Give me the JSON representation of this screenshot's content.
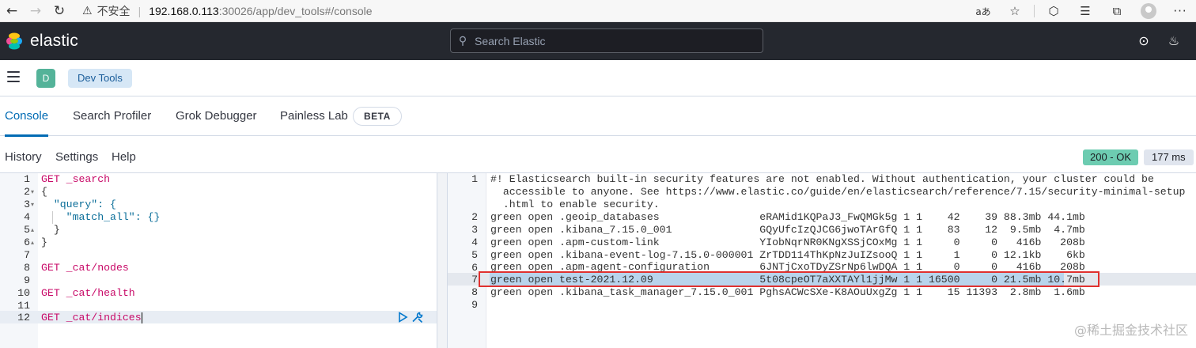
{
  "browser": {
    "back_icon": "←",
    "forward_icon": "→",
    "reload_icon": "↻",
    "warning_icon": "⚠",
    "insecure_label": "不安全",
    "separator": "|",
    "url_host": "192.168.0.113",
    "url_path": ":30026/app/dev_tools#/console",
    "read_aloud_icon": "aあ",
    "favorite_icon": "☆",
    "extensions_icon": "⬡",
    "collections_icon": "☰",
    "tabs_icon": "⧉",
    "menu_icon": "···"
  },
  "header": {
    "brand": "elastic",
    "search_placeholder": "Search Elastic",
    "search_icon": "⚲",
    "help_icon": "⊙",
    "news_icon": "♨"
  },
  "breadcrumb": {
    "space_initial": "D",
    "current": "Dev Tools"
  },
  "tabs": [
    {
      "label": "Console",
      "active": true
    },
    {
      "label": "Search Profiler"
    },
    {
      "label": "Grok Debugger"
    },
    {
      "label": "Painless Lab"
    }
  ],
  "beta_label": "BETA",
  "console_menu": {
    "history": "History",
    "settings": "Settings",
    "help": "Help"
  },
  "response_status": "200 - OK",
  "response_time": "177 ms",
  "request_lines": [
    {
      "n": "1",
      "text": "GET _search"
    },
    {
      "n": "2",
      "text": "{"
    },
    {
      "n": "3",
      "text": "  \"query\": {"
    },
    {
      "n": "4",
      "text": "    \"match_all\": {}"
    },
    {
      "n": "5",
      "text": "  }"
    },
    {
      "n": "6",
      "text": "}"
    },
    {
      "n": "7",
      "text": ""
    },
    {
      "n": "8",
      "text": "GET _cat/nodes"
    },
    {
      "n": "9",
      "text": ""
    },
    {
      "n": "10",
      "text": "GET _cat/health"
    },
    {
      "n": "11",
      "text": ""
    },
    {
      "n": "12",
      "text": "GET _cat/indices"
    }
  ],
  "output": {
    "line_numbers": [
      "1",
      "",
      "",
      "2",
      "3",
      "4",
      "5",
      "6",
      "7",
      "8",
      "9"
    ],
    "lines": [
      "#! Elasticsearch built-in security features are not enabled. Without authentication, your cluster could be",
      "  accessible to anyone. See https://www.elastic.co/guide/en/elasticsearch/reference/7.15/security-minimal-setup",
      "  .html to enable security.",
      "green open .geoip_databases                eRAMid1KQPaJ3_FwQMGk5g 1 1    42    39 88.3mb 44.1mb",
      "green open .kibana_7.15.0_001              GQyUfcIzQJCG6jwoTArGfQ 1 1    83    12  9.5mb  4.7mb",
      "green open .apm-custom-link                YIobNqrNR0KNgXSSjCOxMg 1 1     0     0   416b   208b",
      "green open .kibana-event-log-7.15.0-000001 ZrTDD114ThKpNzJuIZsooQ 1 1     1     0 12.1kb    6kb",
      "green open .apm-agent-configuration        6JNTjCxoTDyZSrNp6lwDQA 1 1     0     0   416b   208b",
      "green open test-2021.12.09                 5t08cpeOT7aXXTAYl1jjMw 1 1 16500     0 21.5mb 10.7mb",
      "green open .kibana_task_manager_7.15.0_001 PghsACWcSXe-K8AOuUxgZg 1 1    15 11393  2.8mb  1.6mb",
      ""
    ]
  },
  "watermark": "@稀土掘金技术社区"
}
